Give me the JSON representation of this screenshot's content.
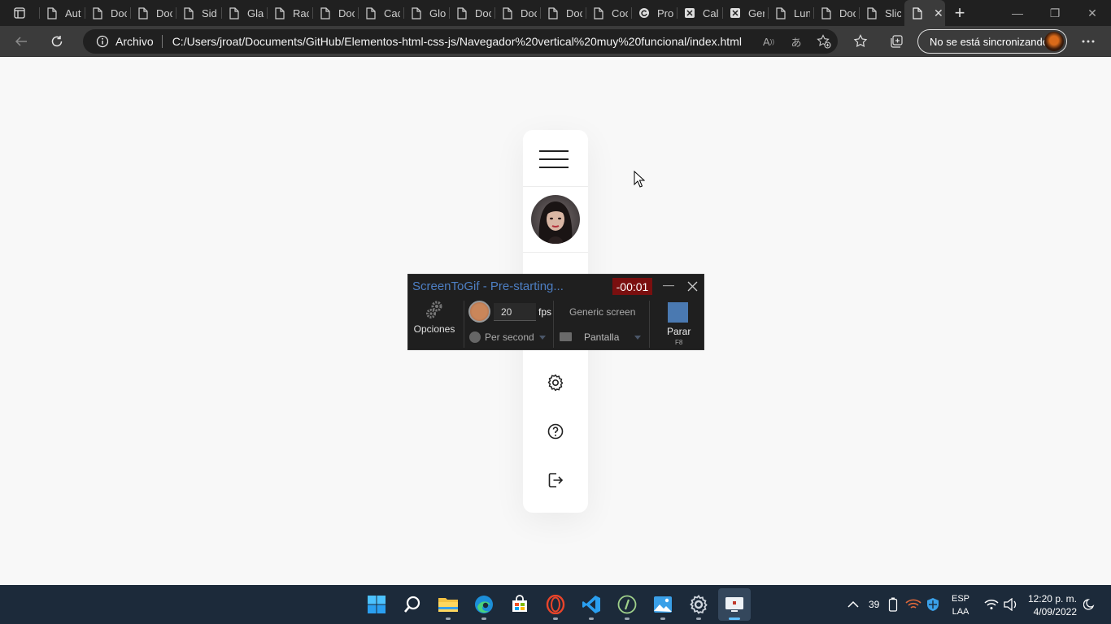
{
  "browser": {
    "tabs": [
      {
        "label": "Aut",
        "icon": "page-icon"
      },
      {
        "label": "Doc",
        "icon": "page-icon"
      },
      {
        "label": "Doc",
        "icon": "page-icon"
      },
      {
        "label": "Sid",
        "icon": "page-icon"
      },
      {
        "label": "Gla",
        "icon": "page-icon"
      },
      {
        "label": "Rac",
        "icon": "page-icon"
      },
      {
        "label": "Doc",
        "icon": "page-icon"
      },
      {
        "label": "Cac",
        "icon": "page-icon"
      },
      {
        "label": "Glo",
        "icon": "page-icon"
      },
      {
        "label": "Doc",
        "icon": "page-icon"
      },
      {
        "label": "Doc",
        "icon": "page-icon"
      },
      {
        "label": "Doc",
        "icon": "page-icon"
      },
      {
        "label": "Coc",
        "icon": "page-icon"
      },
      {
        "label": "Pro",
        "icon": "reload-site-icon"
      },
      {
        "label": "Cal",
        "icon": "site-icon"
      },
      {
        "label": "Ger",
        "icon": "site-icon"
      },
      {
        "label": "Lun",
        "icon": "page-icon"
      },
      {
        "label": "Doc",
        "icon": "page-icon"
      },
      {
        "label": "Slic",
        "icon": "page-icon"
      }
    ],
    "active_tab_icon": "page-icon",
    "address": {
      "site_info_label": "Archivo",
      "url": "C:/Users/jroat/Documents/GitHub/Elementos-html-css-js/Navegador%20vertical%20muy%20funcional/index.html"
    },
    "sync_label": "No se está sincronizando"
  },
  "page": {
    "background": "#f8f8f8",
    "vertical_nav": {
      "items": [
        "menu-icon",
        "profile-avatar",
        "settings-icon",
        "help-icon",
        "logout-icon"
      ]
    }
  },
  "screentogif": {
    "title": "ScreenToGif - Pre-starting...",
    "timer": "-00:01",
    "options_label": "Opciones",
    "fps_value": "20",
    "fps_unit": "fps",
    "per_second_label": "Per second",
    "screen_mode_label": "Generic screen",
    "screen_select_label": "Pantalla",
    "stop_label": "Parar",
    "stop_shortcut": "F8",
    "accent": "#4d7fc4",
    "timer_color": "#7a0f0f"
  },
  "taskbar": {
    "apps": [
      "windows-start-icon",
      "search-icon",
      "file-explorer-icon",
      "edge-icon",
      "store-icon",
      "opera-icon",
      "vscode-icon",
      "app-icon",
      "photos-icon",
      "settings-icon",
      "screentogif-icon"
    ],
    "tray": {
      "badge": "39",
      "lang_line1": "ESP",
      "lang_line2": "LAA",
      "time": "12:20 p. m.",
      "date": "4/09/2022"
    }
  }
}
